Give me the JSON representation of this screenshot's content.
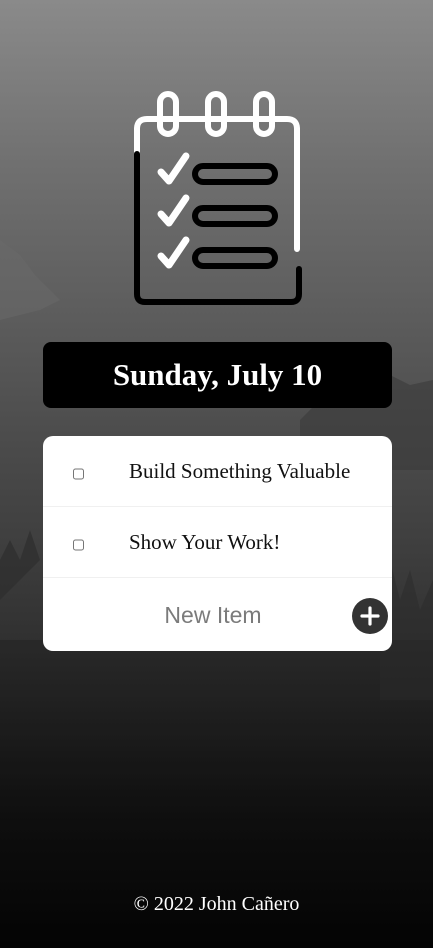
{
  "header": {
    "date": "Sunday, July 10"
  },
  "todo": {
    "items": [
      {
        "label": "Build Something Valuable",
        "checked": false
      },
      {
        "label": "Show Your Work!",
        "checked": false
      }
    ],
    "new_item_placeholder": "New Item",
    "add_button_label": "+"
  },
  "footer": {
    "copyright": "© 2022 John Cañero"
  },
  "icons": {
    "logo": "notepad-checklist-icon",
    "add": "plus-icon"
  }
}
